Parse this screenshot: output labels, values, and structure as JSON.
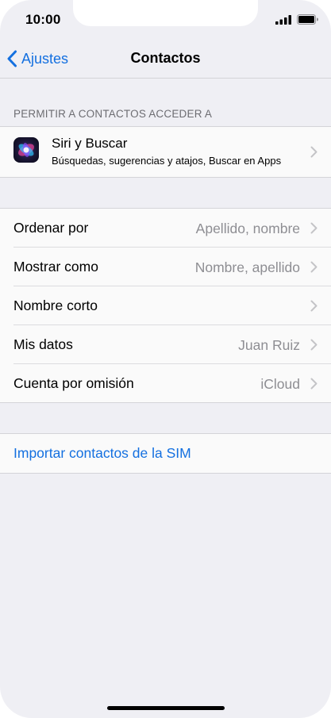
{
  "status_bar": {
    "time": "10:00"
  },
  "nav": {
    "back_label": "Ajustes",
    "title": "Contactos"
  },
  "siri_section": {
    "header": "PERMITIR A CONTACTOS ACCEDER A",
    "title": "Siri y Buscar",
    "subtitle": "Búsquedas, sugerencias y atajos, Buscar en Apps"
  },
  "settings": {
    "rows": [
      {
        "label": "Ordenar por",
        "value": "Apellido, nombre"
      },
      {
        "label": "Mostrar como",
        "value": "Nombre, apellido"
      },
      {
        "label": "Nombre corto",
        "value": ""
      },
      {
        "label": "Mis datos",
        "value": "Juan Ruiz"
      },
      {
        "label": "Cuenta por omisión",
        "value": "iCloud"
      }
    ]
  },
  "import": {
    "label": "Importar contactos de la SIM"
  },
  "colors": {
    "accent": "#1470e0",
    "background": "#efeff4",
    "secondary_text": "#8e8e93"
  }
}
